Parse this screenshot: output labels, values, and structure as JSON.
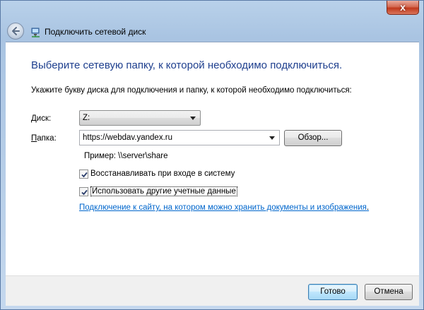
{
  "window": {
    "title": "Подключить сетевой диск",
    "close_glyph": "x"
  },
  "wizard": {
    "heading": "Выберите сетевую папку, к которой необходимо подключиться.",
    "instruction": "Укажите букву диска для подключения и папку, к которой необходимо подключиться:"
  },
  "form": {
    "drive_label_u": "Д",
    "drive_label_rest": "иск:",
    "drive_value": "Z:",
    "folder_label_u": "П",
    "folder_label_rest": "апка:",
    "folder_value": "https://webdav.yandex.ru",
    "browse_label": "Обзор...",
    "example": "Пример: \\\\server\\share",
    "reconnect_label": "Восстанавливать при входе в систему",
    "reconnect_checked": true,
    "other_creds_label": "Использовать другие учетные данные",
    "other_creds_checked": true,
    "link_text": "Подключение к сайту, на котором можно хранить документы и изображения",
    "link_suffix": "."
  },
  "footer": {
    "finish_label": "Готово",
    "cancel_label": "Отмена"
  },
  "colors": {
    "heading": "#1e3f8e",
    "link": "#0066cc",
    "close": "#c0391c"
  }
}
